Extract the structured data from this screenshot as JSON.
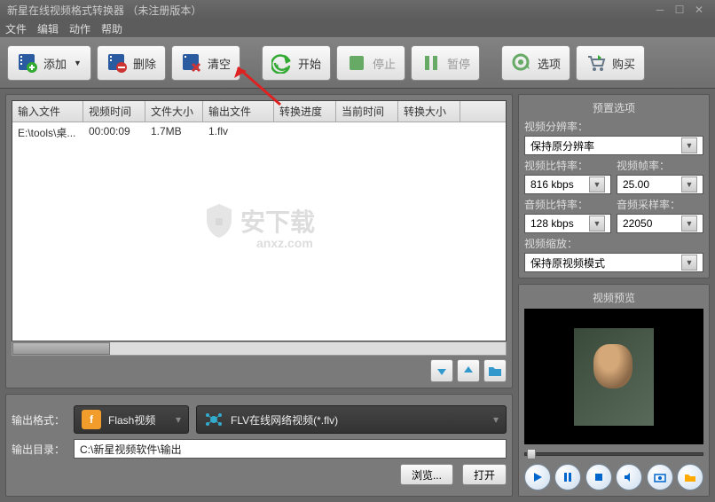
{
  "title": "新星在线视频格式转换器 （未注册版本）",
  "menus": [
    "文件",
    "编辑",
    "动作",
    "帮助"
  ],
  "toolbar": {
    "add": "添加",
    "del": "删除",
    "clear": "清空",
    "start": "开始",
    "stop": "停止",
    "pause": "暂停",
    "options": "选项",
    "buy": "购买"
  },
  "columns": [
    "输入文件",
    "视频时间",
    "文件大小",
    "输出文件",
    "转换进度",
    "当前时间",
    "转换大小"
  ],
  "rows": [
    {
      "input": "E:\\tools\\桌...",
      "time": "00:00:09",
      "size": "1.7MB",
      "output": "1.flv",
      "progress": "",
      "curtime": "",
      "convsize": ""
    }
  ],
  "output": {
    "format_label": "输出格式：",
    "format_cat": "Flash视频",
    "format_name": "FLV在线网络视频(*.flv)",
    "dir_label": "输出目录：",
    "dir": "C:\\新星视频软件\\输出",
    "browse": "浏览...",
    "open": "打开"
  },
  "presets": {
    "title": "预置选项",
    "resolution_label": "视频分辨率：",
    "resolution": "保持原分辨率",
    "vbitrate_label": "视频比特率：",
    "vbitrate": "816 kbps",
    "vfps_label": "视频帧率：",
    "vfps": "25.00",
    "abitrate_label": "音频比特率：",
    "abitrate": "128 kbps",
    "asample_label": "音频采样率：",
    "asample": "22050",
    "scale_label": "视频缩放：",
    "scale": "保持原视频模式"
  },
  "preview_title": "视频预览",
  "watermark": "安下载",
  "watermark_sub": "anxz.com"
}
